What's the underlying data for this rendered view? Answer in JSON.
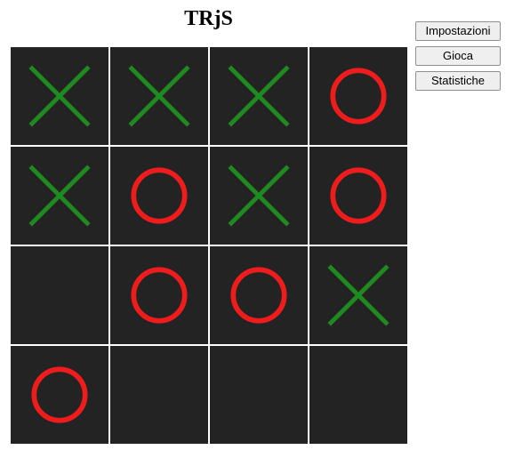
{
  "title": "TRjS",
  "sidebar": {
    "settings_label": "Impostazioni",
    "play_label": "Gioca",
    "stats_label": "Statistiche"
  },
  "colors": {
    "cell_bg": "#232323",
    "x_stroke": "#1f8a1f",
    "o_stroke": "#ee1c1c"
  },
  "board": {
    "rows": 4,
    "cols": 4,
    "cells": [
      [
        "X",
        "X",
        "X",
        "O"
      ],
      [
        "X",
        "O",
        "X",
        "O"
      ],
      [
        "",
        "O",
        "O",
        "X"
      ],
      [
        "O",
        "",
        "",
        ""
      ]
    ]
  }
}
